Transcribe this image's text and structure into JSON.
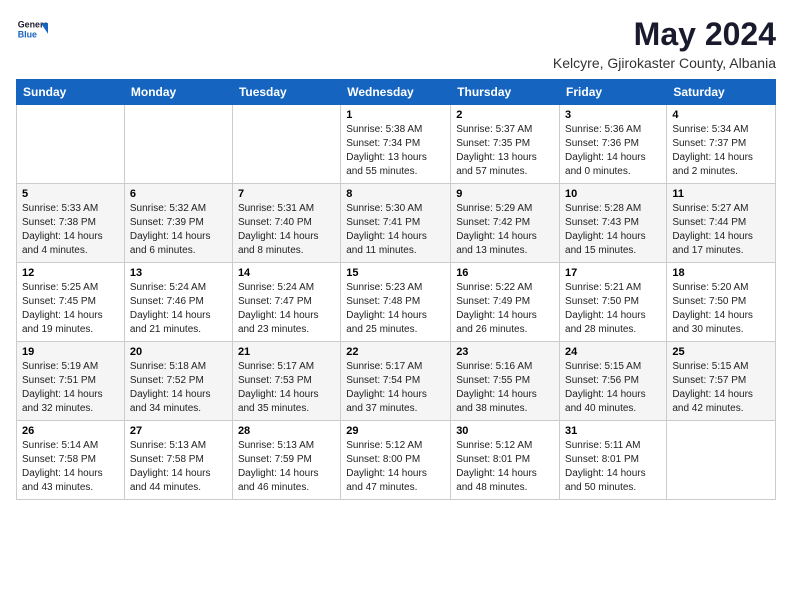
{
  "logo": {
    "general": "General",
    "blue": "Blue"
  },
  "title": "May 2024",
  "location": "Kelcyre, Gjirokaster County, Albania",
  "days_of_week": [
    "Sunday",
    "Monday",
    "Tuesday",
    "Wednesday",
    "Thursday",
    "Friday",
    "Saturday"
  ],
  "weeks": [
    [
      {
        "num": "",
        "info": ""
      },
      {
        "num": "",
        "info": ""
      },
      {
        "num": "",
        "info": ""
      },
      {
        "num": "1",
        "info": "Sunrise: 5:38 AM\nSunset: 7:34 PM\nDaylight: 13 hours\nand 55 minutes."
      },
      {
        "num": "2",
        "info": "Sunrise: 5:37 AM\nSunset: 7:35 PM\nDaylight: 13 hours\nand 57 minutes."
      },
      {
        "num": "3",
        "info": "Sunrise: 5:36 AM\nSunset: 7:36 PM\nDaylight: 14 hours\nand 0 minutes."
      },
      {
        "num": "4",
        "info": "Sunrise: 5:34 AM\nSunset: 7:37 PM\nDaylight: 14 hours\nand 2 minutes."
      }
    ],
    [
      {
        "num": "5",
        "info": "Sunrise: 5:33 AM\nSunset: 7:38 PM\nDaylight: 14 hours\nand 4 minutes."
      },
      {
        "num": "6",
        "info": "Sunrise: 5:32 AM\nSunset: 7:39 PM\nDaylight: 14 hours\nand 6 minutes."
      },
      {
        "num": "7",
        "info": "Sunrise: 5:31 AM\nSunset: 7:40 PM\nDaylight: 14 hours\nand 8 minutes."
      },
      {
        "num": "8",
        "info": "Sunrise: 5:30 AM\nSunset: 7:41 PM\nDaylight: 14 hours\nand 11 minutes."
      },
      {
        "num": "9",
        "info": "Sunrise: 5:29 AM\nSunset: 7:42 PM\nDaylight: 14 hours\nand 13 minutes."
      },
      {
        "num": "10",
        "info": "Sunrise: 5:28 AM\nSunset: 7:43 PM\nDaylight: 14 hours\nand 15 minutes."
      },
      {
        "num": "11",
        "info": "Sunrise: 5:27 AM\nSunset: 7:44 PM\nDaylight: 14 hours\nand 17 minutes."
      }
    ],
    [
      {
        "num": "12",
        "info": "Sunrise: 5:25 AM\nSunset: 7:45 PM\nDaylight: 14 hours\nand 19 minutes."
      },
      {
        "num": "13",
        "info": "Sunrise: 5:24 AM\nSunset: 7:46 PM\nDaylight: 14 hours\nand 21 minutes."
      },
      {
        "num": "14",
        "info": "Sunrise: 5:24 AM\nSunset: 7:47 PM\nDaylight: 14 hours\nand 23 minutes."
      },
      {
        "num": "15",
        "info": "Sunrise: 5:23 AM\nSunset: 7:48 PM\nDaylight: 14 hours\nand 25 minutes."
      },
      {
        "num": "16",
        "info": "Sunrise: 5:22 AM\nSunset: 7:49 PM\nDaylight: 14 hours\nand 26 minutes."
      },
      {
        "num": "17",
        "info": "Sunrise: 5:21 AM\nSunset: 7:50 PM\nDaylight: 14 hours\nand 28 minutes."
      },
      {
        "num": "18",
        "info": "Sunrise: 5:20 AM\nSunset: 7:50 PM\nDaylight: 14 hours\nand 30 minutes."
      }
    ],
    [
      {
        "num": "19",
        "info": "Sunrise: 5:19 AM\nSunset: 7:51 PM\nDaylight: 14 hours\nand 32 minutes."
      },
      {
        "num": "20",
        "info": "Sunrise: 5:18 AM\nSunset: 7:52 PM\nDaylight: 14 hours\nand 34 minutes."
      },
      {
        "num": "21",
        "info": "Sunrise: 5:17 AM\nSunset: 7:53 PM\nDaylight: 14 hours\nand 35 minutes."
      },
      {
        "num": "22",
        "info": "Sunrise: 5:17 AM\nSunset: 7:54 PM\nDaylight: 14 hours\nand 37 minutes."
      },
      {
        "num": "23",
        "info": "Sunrise: 5:16 AM\nSunset: 7:55 PM\nDaylight: 14 hours\nand 38 minutes."
      },
      {
        "num": "24",
        "info": "Sunrise: 5:15 AM\nSunset: 7:56 PM\nDaylight: 14 hours\nand 40 minutes."
      },
      {
        "num": "25",
        "info": "Sunrise: 5:15 AM\nSunset: 7:57 PM\nDaylight: 14 hours\nand 42 minutes."
      }
    ],
    [
      {
        "num": "26",
        "info": "Sunrise: 5:14 AM\nSunset: 7:58 PM\nDaylight: 14 hours\nand 43 minutes."
      },
      {
        "num": "27",
        "info": "Sunrise: 5:13 AM\nSunset: 7:58 PM\nDaylight: 14 hours\nand 44 minutes."
      },
      {
        "num": "28",
        "info": "Sunrise: 5:13 AM\nSunset: 7:59 PM\nDaylight: 14 hours\nand 46 minutes."
      },
      {
        "num": "29",
        "info": "Sunrise: 5:12 AM\nSunset: 8:00 PM\nDaylight: 14 hours\nand 47 minutes."
      },
      {
        "num": "30",
        "info": "Sunrise: 5:12 AM\nSunset: 8:01 PM\nDaylight: 14 hours\nand 48 minutes."
      },
      {
        "num": "31",
        "info": "Sunrise: 5:11 AM\nSunset: 8:01 PM\nDaylight: 14 hours\nand 50 minutes."
      },
      {
        "num": "",
        "info": ""
      }
    ]
  ]
}
